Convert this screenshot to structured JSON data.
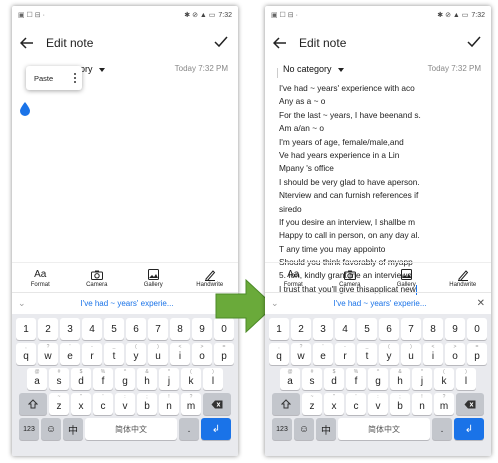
{
  "status_bar": {
    "time": "7:32",
    "left_icons": "▣ ☐ ⊟ ·",
    "right_icons": "✱ ⊘ ▲ ▭"
  },
  "app_bar": {
    "title": "Edit note",
    "back_icon": "back-arrow-icon",
    "save_icon": "check-icon"
  },
  "left_phone": {
    "category_partial": "ory",
    "datetime": "Today 7:32 PM",
    "paste_label": "Paste"
  },
  "right_phone": {
    "category": "No category",
    "datetime": "Today 7:32 PM",
    "lines": [
      "I've had ~ years' experience with aco",
      "Any as a ~ o",
      "For the last ~ years, I have beenand s.",
      "Am a/an ~ o",
      "I'm years of age, female/male,and",
      "Ve had years experience in a Lin",
      "Mpany 's office",
      "I should be very glad to have aperson.",
      "Nterview and can furnish references if",
      "siredo",
      "If you desire an interview, I shallbe m",
      "Happy to call in person, on any day al.",
      "T any time you may appointo",
      "Should you think favorably of myapp",
      "5. Ion, kindly grant me an interviewo",
      "I trust that you'll give thisapplicat new"
    ]
  },
  "toolbar": {
    "format": "Format",
    "camera": "Camera",
    "gallery": "Gallery",
    "handwrite": "Handwrite",
    "format_glyph": "Aa"
  },
  "suggestion": {
    "text": "I've had ~ years' experie...",
    "chevron": "⌄",
    "close": "✕"
  },
  "keyboard": {
    "row_numbers": [
      "1",
      "2",
      "3",
      "4",
      "5",
      "6",
      "7",
      "8",
      "9",
      "0"
    ],
    "row_q": [
      {
        "k": "q",
        "s": ","
      },
      {
        "k": "w",
        "s": "?"
      },
      {
        "k": "e",
        "s": "'"
      },
      {
        "k": "r",
        "s": "-"
      },
      {
        "k": "t",
        "s": "_"
      },
      {
        "k": "y",
        "s": "("
      },
      {
        "k": "u",
        "s": ")"
      },
      {
        "k": "i",
        "s": "<"
      },
      {
        "k": "o",
        "s": ">"
      },
      {
        "k": "p",
        "s": "="
      }
    ],
    "row_a": [
      {
        "k": "a",
        "s": "@"
      },
      {
        "k": "s",
        "s": "#"
      },
      {
        "k": "d",
        "s": "$"
      },
      {
        "k": "f",
        "s": "%"
      },
      {
        "k": "g",
        "s": "^"
      },
      {
        "k": "h",
        "s": "&"
      },
      {
        "k": "j",
        "s": "*"
      },
      {
        "k": "k",
        "s": "("
      },
      {
        "k": "l",
        "s": ")"
      }
    ],
    "row_z": [
      {
        "k": "z",
        "s": "~"
      },
      {
        "k": "x",
        "s": "\""
      },
      {
        "k": "c",
        "s": "'"
      },
      {
        "k": "v",
        "s": ":"
      },
      {
        "k": "b",
        "s": ";"
      },
      {
        "k": "n",
        "s": "!"
      },
      {
        "k": "m",
        "s": "?"
      }
    ],
    "numeric_key": "123",
    "emoji": "☺",
    "lang_switch": "中",
    "space": "简体中文",
    "period": ".",
    "enter": "↲"
  },
  "accent_color": "#1a73e8",
  "arrow_color": "#6aaa3a"
}
